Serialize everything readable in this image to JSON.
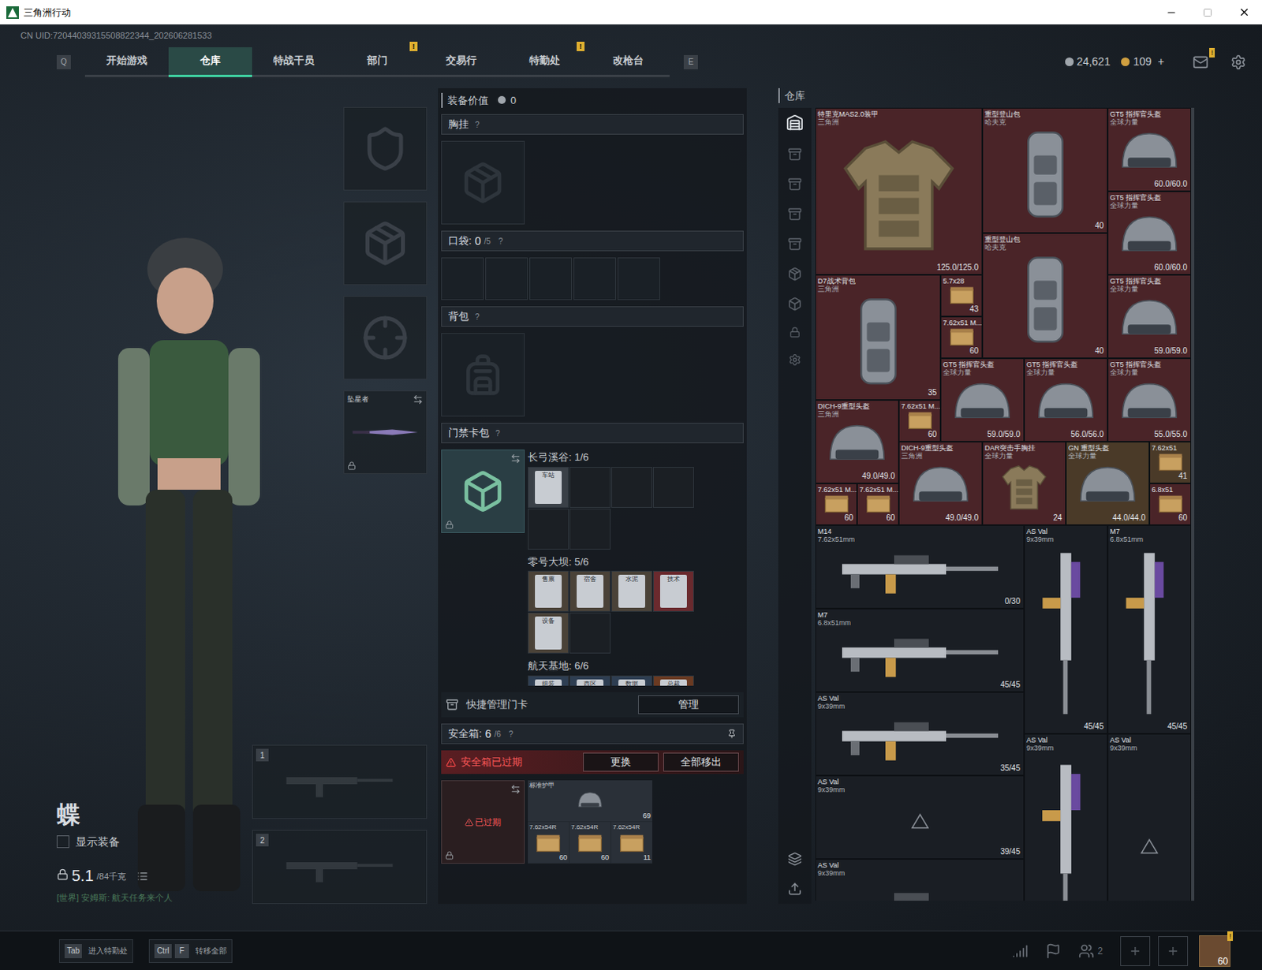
{
  "window": {
    "title": "三角洲行动",
    "uid": "CN UID:72044039315508822344_202606281533"
  },
  "nav": {
    "left_key": "Q",
    "right_key": "E",
    "tabs": [
      {
        "label": "开始游戏",
        "selected": false,
        "badge": ""
      },
      {
        "label": "仓库",
        "selected": true,
        "badge": ""
      },
      {
        "label": "特战干员",
        "selected": false,
        "badge": ""
      },
      {
        "label": "部门",
        "selected": false,
        "badge": "!"
      },
      {
        "label": "交易行",
        "selected": false,
        "badge": ""
      },
      {
        "label": "特勤处",
        "selected": false,
        "badge": "!"
      },
      {
        "label": "改枪台",
        "selected": false,
        "badge": ""
      }
    ]
  },
  "currency": {
    "coins": "24,621",
    "gems": "109",
    "add": "+",
    "mail_badge": "!"
  },
  "operator": {
    "name": "蝶",
    "show_gear": {
      "label": "显示装备",
      "checked": false
    },
    "weight": "5.1",
    "weight_max": "/84千克",
    "chat": "[世界] 安姆斯: 航天任务来个人"
  },
  "gear_slots": [
    {
      "kind": "helmet",
      "label": "",
      "locked": false
    },
    {
      "kind": "armor",
      "label": "",
      "locked": false
    },
    {
      "kind": "pistol",
      "label": "",
      "locked": false
    },
    {
      "kind": "melee",
      "label": "坠星者",
      "locked": true
    }
  ],
  "weapon_slots": [
    {
      "number": "1"
    },
    {
      "number": "2"
    }
  ],
  "loadout": {
    "value_label": "装备价值",
    "value": "0",
    "chest": {
      "label": "胸挂",
      "help": "?"
    },
    "pockets": {
      "label": "口袋: ",
      "count": "0",
      "max": "/5",
      "help": "?",
      "slots": [
        {
          "filled": false
        },
        {
          "filled": false
        },
        {
          "filled": false
        },
        {
          "filled": false
        },
        {
          "filled": false
        }
      ]
    },
    "backpack": {
      "label": "背包",
      "help": "?"
    },
    "keycard_bag": {
      "label": "门禁卡包",
      "help": "?",
      "locked": true,
      "maps": [
        {
          "name": "长弓溪谷: 1/6",
          "cards": [
            {
              "label": "车站",
              "filled": true,
              "color": "#3a4047"
            },
            {
              "label": "",
              "filled": false,
              "color": "#1b1f24"
            },
            {
              "label": "",
              "filled": false,
              "color": "#1b1f24"
            },
            {
              "label": "",
              "filled": false,
              "color": "#1b1f24"
            },
            {
              "label": "",
              "filled": false,
              "color": "#1b1f24"
            },
            {
              "label": "",
              "filled": false,
              "color": "#1b1f24"
            }
          ]
        },
        {
          "name": "零号大坝: 5/6",
          "cards": [
            {
              "label": "售票",
              "filled": true,
              "color": "#4a4238"
            },
            {
              "label": "宿舍",
              "filled": true,
              "color": "#4a4238"
            },
            {
              "label": "水泥",
              "filled": true,
              "color": "#4a4238"
            },
            {
              "label": "技术",
              "filled": true,
              "color": "#6a2a2e"
            },
            {
              "label": "设备",
              "filled": true,
              "color": "#4a4238"
            },
            {
              "label": "",
              "filled": false,
              "color": "#1b1f24"
            }
          ]
        },
        {
          "name": "航天基地: 6/6",
          "cards": [
            {
              "label": "组装",
              "filled": true,
              "color": "#2e3e52"
            },
            {
              "label": "西区",
              "filled": true,
              "color": "#2e3e52"
            },
            {
              "label": "数据",
              "filled": true,
              "color": "#2e3e52"
            },
            {
              "label": "总裁",
              "filled": true,
              "color": "#6a3a22"
            }
          ]
        }
      ]
    },
    "quick_manage": {
      "label": "快捷管理门卡",
      "button": "管理"
    },
    "safe_box": {
      "label": "安全箱: ",
      "count": "6",
      "max": "/6",
      "help": "?",
      "warning": "安全箱已过期",
      "buttons": [
        "更换",
        "全部移出"
      ],
      "expired": "已过期",
      "items": [
        {
          "name": "标准护甲",
          "value": "69",
          "kind": "armor"
        },
        {
          "name": "7.62x54R",
          "value": "60",
          "kind": "ammo"
        },
        {
          "name": "7.62x54R",
          "value": "60",
          "kind": "ammo"
        },
        {
          "name": "7.62x54R",
          "value": "11",
          "kind": "ammo"
        }
      ]
    }
  },
  "warehouse": {
    "title": "仓库",
    "items": [
      {
        "name": "特里克MAS2.0装甲",
        "brand": "三角洲",
        "value": "125.0/125.0",
        "kind": "armor",
        "color": "#4a2428"
      },
      {
        "name": "重型登山包",
        "brand": "哈夫克",
        "value": "40",
        "kind": "bag",
        "color": "#4a2428"
      },
      {
        "name": "GT5 指挥官头盔",
        "brand": "全球力量",
        "value": "60.0/60.0",
        "kind": "helmet",
        "color": "#4a2428"
      },
      {
        "name": "GT5 指挥官头盔",
        "brand": "全球力量",
        "value": "60.0/60.0",
        "kind": "helmet",
        "color": "#4a2428"
      },
      {
        "name": "重型登山包",
        "brand": "哈夫克",
        "value": "40",
        "kind": "bag",
        "color": "#4a2428"
      },
      {
        "name": "D7战术背包",
        "brand": "三角洲",
        "value": "35",
        "kind": "bag",
        "color": "#4a2428"
      },
      {
        "name": "5.7x28",
        "brand": "",
        "value": "43",
        "kind": "ammo",
        "color": "#4a2428"
      },
      {
        "name": "7.62x51 M...",
        "brand": "",
        "value": "60",
        "kind": "ammo",
        "color": "#4a2428"
      },
      {
        "name": "GT5 指挥官头盔",
        "brand": "全球力量",
        "value": "59.0/59.0",
        "kind": "helmet",
        "color": "#4a2428"
      },
      {
        "name": "GT5 指挥官头盔",
        "brand": "全球力量",
        "value": "59.0/59.0",
        "kind": "helmet",
        "color": "#4a2428"
      },
      {
        "name": "GT5 指挥官头盔",
        "brand": "全球力量",
        "value": "56.0/56.0",
        "kind": "helmet",
        "color": "#4a2428"
      },
      {
        "name": "GT5 指挥官头盔",
        "brand": "全球力量",
        "value": "55.0/55.0",
        "kind": "helmet",
        "color": "#4a2428"
      },
      {
        "name": "DICH-9重型头盔",
        "brand": "三角洲",
        "value": "49.0/49.0",
        "kind": "helmet",
        "color": "#4a2428"
      },
      {
        "name": "7.62x51 M...",
        "brand": "",
        "value": "60",
        "kind": "ammo",
        "color": "#4a2428"
      },
      {
        "name": "DICH-9重型头盔",
        "brand": "三角洲",
        "value": "49.0/49.0",
        "kind": "helmet",
        "color": "#4a2428"
      },
      {
        "name": "DAR突击手胸挂",
        "brand": "全球力量",
        "value": "24",
        "kind": "chest",
        "color": "#4a2428"
      },
      {
        "name": "GN 重型头盔",
        "brand": "全球力量",
        "value": "44.0/44.0",
        "kind": "helmet",
        "color": "#4a3a28"
      },
      {
        "name": "7.62x51",
        "brand": "",
        "value": "41",
        "kind": "ammo",
        "color": "#4a3a28"
      },
      {
        "name": "7.62x51 M...",
        "brand": "",
        "value": "60",
        "kind": "ammo",
        "color": "#4a2428"
      },
      {
        "name": "7.62x51 M...",
        "brand": "",
        "value": "60",
        "kind": "ammo",
        "color": "#4a2428"
      },
      {
        "name": "6.8x51",
        "brand": "",
        "value": "60",
        "kind": "ammo",
        "color": "#4a2428"
      },
      {
        "name": "M14",
        "brand": "7.62x51mm",
        "value": "0/30",
        "kind": "rifle",
        "color": "#1a1e24"
      },
      {
        "name": "AS Val",
        "brand": "9x39mm",
        "value": "45/45",
        "kind": "rifle-v",
        "color": "#1a1e24"
      },
      {
        "name": "M7",
        "brand": "6.8x51mm",
        "value": "45/45",
        "kind": "rifle-v",
        "color": "#1a1e24"
      },
      {
        "name": "M7",
        "brand": "6.8x51mm",
        "value": "45/45",
        "kind": "rifle",
        "color": "#1a1e24"
      },
      {
        "name": "AS Val",
        "brand": "9x39mm",
        "value": "35/45",
        "kind": "rifle",
        "color": "#1a1e24"
      },
      {
        "name": "AS Val",
        "brand": "9x39mm",
        "value": "",
        "kind": "rifle-v",
        "color": "#1a1e24"
      },
      {
        "name": "AS Val",
        "brand": "9x39mm",
        "value": "",
        "kind": "placeholder",
        "color": "#1a1e24"
      },
      {
        "name": "AS Val",
        "brand": "9x39mm",
        "value": "39/45",
        "kind": "placeholder",
        "color": "#1a1e24"
      },
      {
        "name": "AS Val",
        "brand": "9x39mm",
        "value": "",
        "kind": "rifle",
        "color": "#1a1e24"
      }
    ]
  },
  "bottom_bar": {
    "hints": [
      {
        "keys": [
          "Tab"
        ],
        "label": "进入特勤处"
      },
      {
        "keys": [
          "Ctrl",
          "F"
        ],
        "label": "转移全部"
      }
    ],
    "squad_count": "2",
    "level": "60",
    "level_badge": "!"
  }
}
